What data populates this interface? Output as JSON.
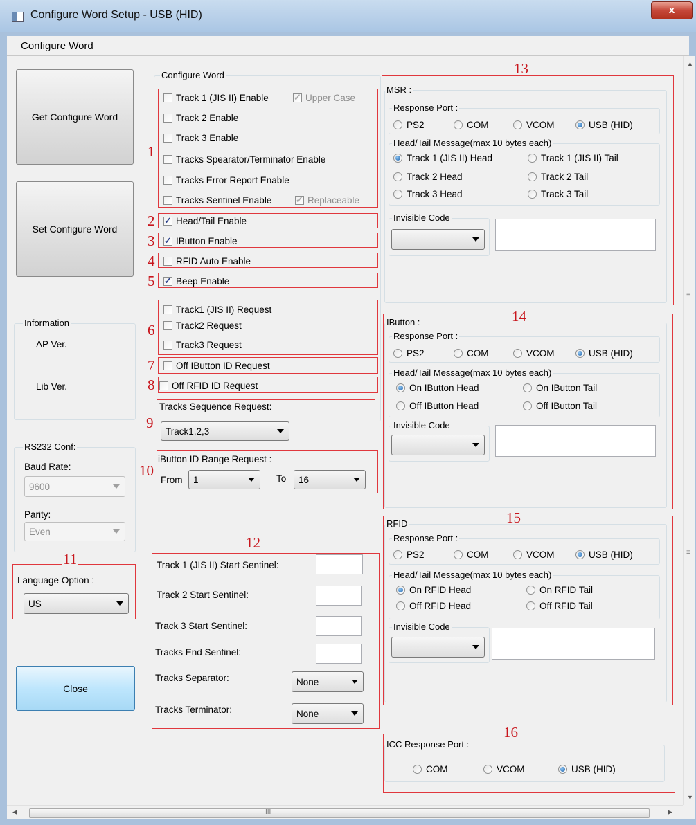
{
  "window": {
    "title": "Configure Word Setup - USB (HID)",
    "close_glyph": "x"
  },
  "menu": {
    "configure_word": "Configure Word"
  },
  "left": {
    "get_button": "Get Configure Word",
    "set_button": "Set Configure Word",
    "info_title": "Information",
    "ap_ver": "AP Ver.",
    "lib_ver": "Lib Ver.",
    "rs232_title": "RS232 Conf:",
    "baud_label": "Baud Rate:",
    "baud_value": "9600",
    "parity_label": "Parity:",
    "parity_value": "Even",
    "lang_title": "Language Option :",
    "lang_value": "US",
    "close_button": "Close"
  },
  "annotations": [
    "1",
    "2",
    "3",
    "4",
    "5",
    "6",
    "7",
    "8",
    "9",
    "10",
    "11",
    "12",
    "13",
    "14",
    "15",
    "16"
  ],
  "configure_word": {
    "title": "Configure Word",
    "track1_enable": "Track 1 (JIS II) Enable",
    "upper_case": "Upper Case",
    "track2_enable": "Track 2 Enable",
    "track3_enable": "Track 3 Enable",
    "separator_enable": "Tracks Spearator/Terminator Enable",
    "error_report": "Tracks Error Report Enable",
    "sentinel_enable": "Tracks Sentinel Enable",
    "replaceable": "Replaceable",
    "head_tail": "Head/Tail Enable",
    "ibutton_enable": "IButton Enable",
    "rfid_auto": "RFID Auto Enable",
    "beep_enable": "Beep Enable",
    "track1_request": "Track1 (JIS II) Request",
    "track2_request": "Track2 Request",
    "track3_request": "Track3 Request",
    "off_ibutton_request": "Off IButton ID Request",
    "off_rfid_request": "Off RFID ID Request",
    "seq_label": "Tracks Sequence Request:",
    "seq_value": "Track1,2,3",
    "range_label": "iButton ID Range Request :",
    "from_label": "From",
    "from_value": "1",
    "to_label": "To",
    "to_value": "16",
    "t1_start": "Track 1 (JIS II) Start Sentinel:",
    "t2_start": "Track 2 Start Sentinel:",
    "t3_start": "Track 3 Start Sentinel:",
    "end_sentinel": "Tracks End Sentinel:",
    "separator": "Tracks Separator:",
    "separator_value": "None",
    "terminator": "Tracks Terminator:",
    "terminator_value": "None"
  },
  "msr": {
    "title": "MSR :",
    "response_port": "Response Port :",
    "ports": [
      "PS2",
      "COM",
      "VCOM",
      "USB (HID)"
    ],
    "head_tail_title": "Head/Tail Message(max 10 bytes each)",
    "options": [
      "Track 1 (JIS II) Head",
      "Track 1 (JIS II) Tail",
      "Track 2 Head",
      "Track 2 Tail",
      "Track 3 Head",
      "Track 3 Tail"
    ],
    "invisible_code": "Invisible Code"
  },
  "ibutton": {
    "title": "IButton :",
    "response_port": "Response Port :",
    "ports": [
      "PS2",
      "COM",
      "VCOM",
      "USB (HID)"
    ],
    "head_tail_title": "Head/Tail Message(max 10 bytes each)",
    "options": [
      "On IButton Head",
      "On IButton Tail",
      "Off IButton Head",
      "Off IButton Tail"
    ],
    "invisible_code": "Invisible Code"
  },
  "rfid": {
    "title": "RFID",
    "response_port": "Response Port :",
    "ports": [
      "PS2",
      "COM",
      "VCOM",
      "USB (HID)"
    ],
    "head_tail_title": "Head/Tail Message(max 10 bytes each)",
    "options": [
      "On RFID Head",
      "On RFID Tail",
      "Off RFID Head",
      "Off RFID Tail"
    ],
    "invisible_code": "Invisible Code"
  },
  "icc": {
    "title": "ICC Response Port :",
    "ports": [
      "COM",
      "VCOM",
      "USB (HID)"
    ]
  },
  "scrollbar": {
    "h_grip": "III",
    "v_grip": "≡"
  }
}
